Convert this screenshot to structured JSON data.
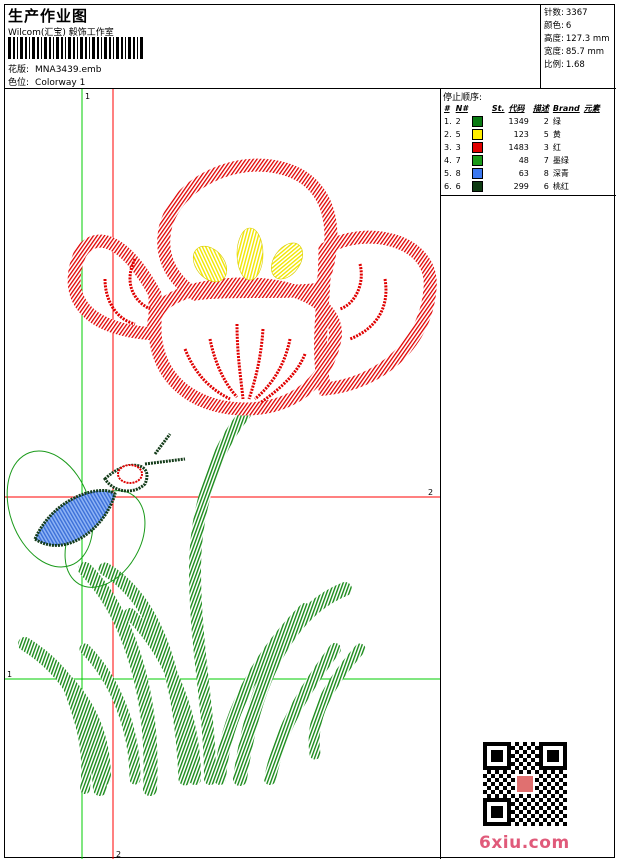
{
  "header": {
    "title": "生产作业图",
    "subtitle": "Wilcom(汇宝) 毅饰工作室",
    "design_label": "花版:",
    "design_value": "MNA3439.emb",
    "colorway_label": "色位:",
    "colorway_value": "Colorway 1"
  },
  "stats": [
    {
      "label": "针数:",
      "value": "3367"
    },
    {
      "label": "颜色:",
      "value": "6"
    },
    {
      "label": "高度:",
      "value": "127.3 mm"
    },
    {
      "label": "宽度:",
      "value": "85.7 mm"
    },
    {
      "label": "比例:",
      "value": "1.68"
    }
  ],
  "stop_sequence": {
    "title": "停止顺序:",
    "columns": [
      "#",
      "N#",
      "St.",
      "代码",
      "描述",
      "Brand",
      "元素"
    ],
    "rows": [
      {
        "n": "1.",
        "nn": "2",
        "color": "#0a7a12",
        "st": "1349",
        "code": "2",
        "desc": "绿"
      },
      {
        "n": "2.",
        "nn": "5",
        "color": "#ffee00",
        "st": "123",
        "code": "5",
        "desc": "黄"
      },
      {
        "n": "3.",
        "nn": "3",
        "color": "#e00000",
        "st": "1483",
        "code": "3",
        "desc": "红"
      },
      {
        "n": "4.",
        "nn": "7",
        "color": "#1a9a1a",
        "st": "48",
        "code": "7",
        "desc": "墨绿"
      },
      {
        "n": "5.",
        "nn": "8",
        "color": "#3b78f0",
        "st": "63",
        "code": "8",
        "desc": "深青"
      },
      {
        "n": "6.",
        "nn": "6",
        "color": "#0e3a12",
        "st": "299",
        "code": "6",
        "desc": "桃红"
      }
    ]
  },
  "axes": {
    "v1": "1",
    "v2": "2",
    "h1": "1",
    "h2": "2"
  },
  "watermark": "6xiu.com",
  "colors": {
    "red": "#e00000",
    "green": "#1a8a1a",
    "yellow": "#f2e600",
    "blue": "#4a86e8",
    "dark": "#143c1a",
    "guide_red": "#ff0000",
    "guide_green": "#00cc00"
  }
}
